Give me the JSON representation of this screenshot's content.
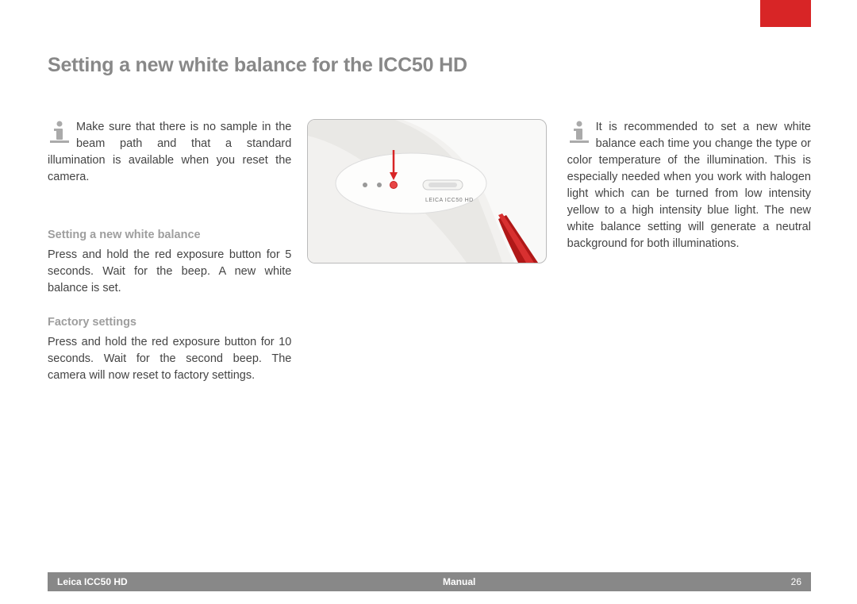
{
  "title": "Setting a new white balance for the ICC50 HD",
  "col1": {
    "info_para": "Make sure that there is no sample in the beam path and that a standard illumination is available when you reset the camera.",
    "sub1_head": "Setting a new white balance",
    "sub1_body": "Press and hold the red exposure button for 5 seconds. Wait for the beep. A new white balance is set.",
    "sub2_head": "Factory settings",
    "sub2_body": "Press and hold the red exposure button for 10 seconds. Wait for the second beep. The camera will now reset to factory settings."
  },
  "image_label": "LEICA ICC50 HD",
  "col3": {
    "info_para": "It is recommended to set a new white balance each time you change the type or color temperature of the illumination. This is especially needed when you work with halogen light which can be turned from low intensity yellow to a high intensity blue light. The new white balance setting will generate a neutral background for both illuminations."
  },
  "footer": {
    "left": "Leica ICC50 HD",
    "center": "Manual",
    "right": "26"
  }
}
